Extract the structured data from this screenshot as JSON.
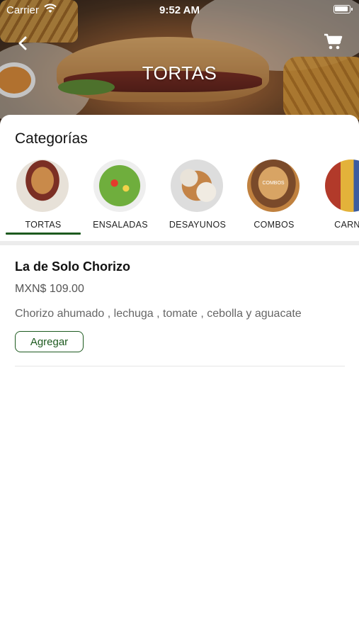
{
  "status_bar": {
    "carrier": "Carrier",
    "time": "9:52 AM"
  },
  "header": {
    "title": "TORTAS",
    "back_icon": "chevron-left-icon",
    "cart_icon": "cart-icon"
  },
  "categories": {
    "title": "Categorías",
    "selected": "TORTAS",
    "items": [
      {
        "label": "TORTAS"
      },
      {
        "label": "ENSALADAS"
      },
      {
        "label": "DESAYUNOS"
      },
      {
        "label": "COMBOS",
        "image_text": "COMBOS"
      },
      {
        "label": "CARNIC"
      }
    ]
  },
  "products": [
    {
      "name": "La de Solo Chorizo",
      "price": "MXN$ 109.00",
      "description": "Chorizo ahumado , lechuga , tomate , cebolla y aguacate",
      "add_label": "Agregar"
    }
  ],
  "colors": {
    "accent": "#1d5a1f",
    "divider": "#ececec"
  }
}
